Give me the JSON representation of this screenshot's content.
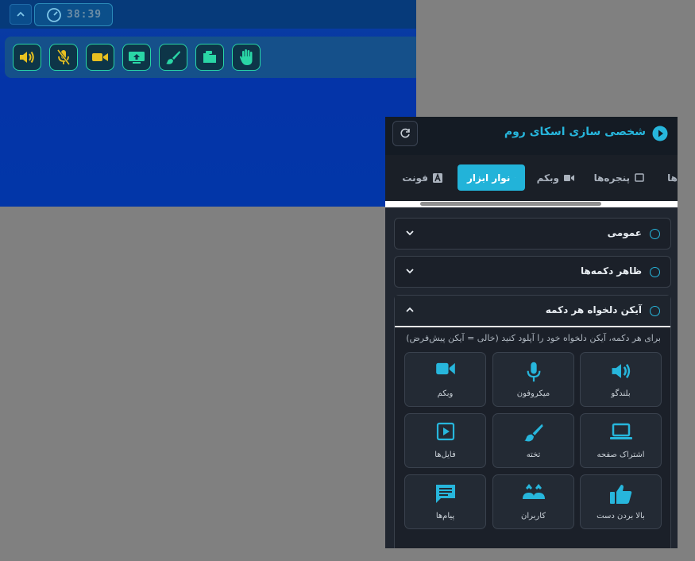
{
  "preview": {
    "timer": "38:39",
    "toolbar_buttons": [
      {
        "name": "speaker",
        "icon": "speaker-icon",
        "color": "#e8c020"
      },
      {
        "name": "microphone-muted",
        "icon": "mic-off-icon",
        "color": "#e8c020"
      },
      {
        "name": "webcam",
        "icon": "camera-icon",
        "color": "#e8c020"
      },
      {
        "name": "screen-share",
        "icon": "screen-share-icon",
        "color": "#2ad6a6"
      },
      {
        "name": "whiteboard",
        "icon": "brush-icon",
        "color": "#2ad6a6"
      },
      {
        "name": "files",
        "icon": "folder-icon",
        "color": "#2ad6a6"
      },
      {
        "name": "raise-hand",
        "icon": "hand-icon",
        "color": "#2ad6a6"
      }
    ]
  },
  "panel": {
    "title": "شخصی سازی اسکای روم",
    "tabs": [
      {
        "label": "ها",
        "icon": ""
      },
      {
        "label": "پنجره‌ها",
        "icon": "window-icon"
      },
      {
        "label": "وبکم",
        "icon": "camera-icon"
      },
      {
        "label": "نوار ابزار",
        "icon": "wrench-icon",
        "active": true
      },
      {
        "label": "فونت",
        "icon": "font-icon"
      }
    ],
    "sections": {
      "general": "عمومی",
      "button_appearance": "ظاهر دکمه‌ها",
      "custom_icons": "آیکن دلخواه هر دکمه"
    },
    "hint": "برای هر دکمه، آیکن دلخواه خود را آپلود کنید (خالی = آیکن پیش‌فرض)",
    "icon_cards": [
      {
        "label": "بلندگو",
        "icon": "speaker-icon"
      },
      {
        "label": "میکروفون",
        "icon": "microphone-icon"
      },
      {
        "label": "وبکم",
        "icon": "camera-icon"
      },
      {
        "label": "اشتراک صفحه",
        "icon": "laptop-icon"
      },
      {
        "label": "تخته",
        "icon": "brush-icon"
      },
      {
        "label": "فایل‌ها",
        "icon": "play-file-icon"
      },
      {
        "label": "بالا بردن دست",
        "icon": "thumbs-up-icon"
      },
      {
        "label": "کاربران",
        "icon": "users-icon"
      },
      {
        "label": "پیام‌ها",
        "icon": "chat-icon"
      }
    ],
    "accent": "#22b3d9"
  }
}
